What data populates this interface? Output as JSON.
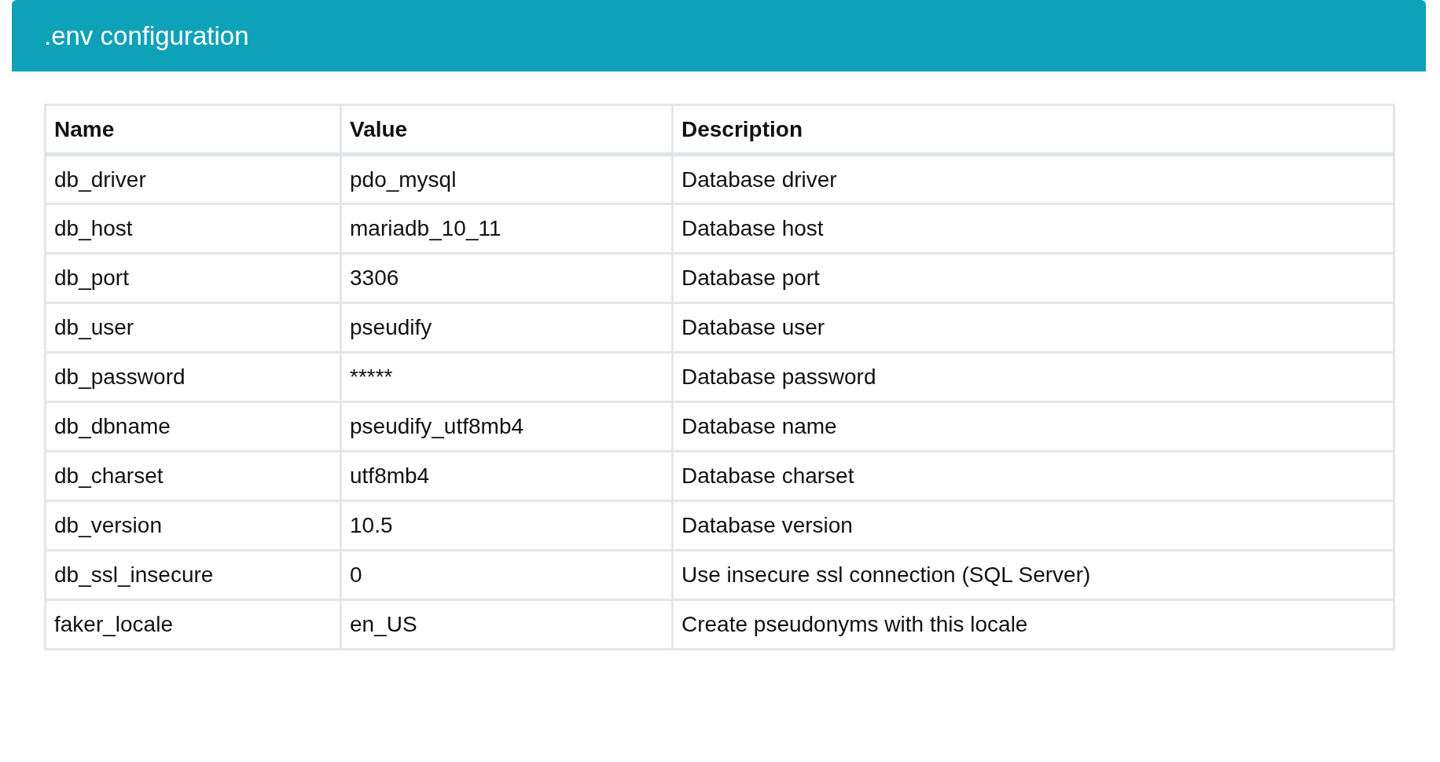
{
  "header": {
    "title": ".env configuration"
  },
  "table": {
    "columns": [
      "Name",
      "Value",
      "Description"
    ],
    "rows": [
      [
        "db_driver",
        "pdo_mysql",
        "Database driver"
      ],
      [
        "db_host",
        "mariadb_10_11",
        "Database host"
      ],
      [
        "db_port",
        "3306",
        "Database port"
      ],
      [
        "db_user",
        "pseudify",
        "Database user"
      ],
      [
        "db_password",
        "*****",
        "Database password"
      ],
      [
        "db_dbname",
        "pseudify_utf8mb4",
        "Database name"
      ],
      [
        "db_charset",
        "utf8mb4",
        "Database charset"
      ],
      [
        "db_version",
        "10.5",
        "Database version"
      ],
      [
        "db_ssl_insecure",
        "0",
        "Use insecure ssl connection (SQL Server)"
      ],
      [
        "faker_locale",
        "en_US",
        "Create pseudonyms with this locale"
      ]
    ]
  }
}
